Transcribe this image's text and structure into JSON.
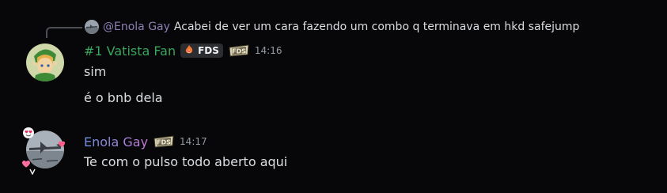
{
  "reply": {
    "author": "@Enola Gay",
    "text": "Acabei de ver um cara fazendo um combo q terminava em hkd safejump"
  },
  "messages": [
    {
      "author": "#1 Vatista Fan",
      "author_color": "#3ba55d",
      "tag": {
        "emoji": "flame-heart",
        "label": "FDS"
      },
      "badge_icon": "fds-clan-badge-icon",
      "timestamp": "14:16",
      "lines": [
        "sim",
        "é o bnb dela"
      ]
    },
    {
      "author": "Enola Gay",
      "author_color": "#7b8fd4",
      "badge_icon": "fds-clan-badge-icon",
      "timestamp": "14:17",
      "lines": [
        "Te com o pulso todo aberto aqui"
      ]
    }
  ]
}
